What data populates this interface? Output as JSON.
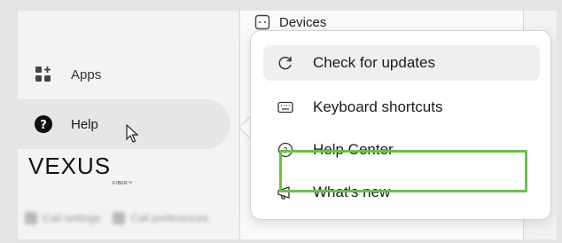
{
  "sidebar": {
    "items": [
      {
        "label": "Apps",
        "icon": "apps-icon"
      },
      {
        "label": "Help",
        "icon": "help-circle-icon",
        "active": true
      }
    ],
    "logo": {
      "text": "VEXUS",
      "sub": "FIBER™"
    },
    "blurred_items": [
      "Call settings",
      "Call preferences"
    ]
  },
  "devices_panel": {
    "label": "Devices",
    "icon": "devices-icon"
  },
  "help_menu": {
    "items": [
      {
        "label": "Check for updates",
        "icon": "refresh-icon"
      },
      {
        "label": "Keyboard shortcuts",
        "icon": "keyboard-icon"
      },
      {
        "label": "Help Center",
        "icon": "help-outline-icon",
        "highlighted": true
      },
      {
        "label": "What's new",
        "icon": "megaphone-icon"
      }
    ]
  },
  "colors": {
    "highlight_border": "#6cc04a",
    "hover_bg": "#efefef",
    "active_nav_bg": "#e6e6e6"
  }
}
